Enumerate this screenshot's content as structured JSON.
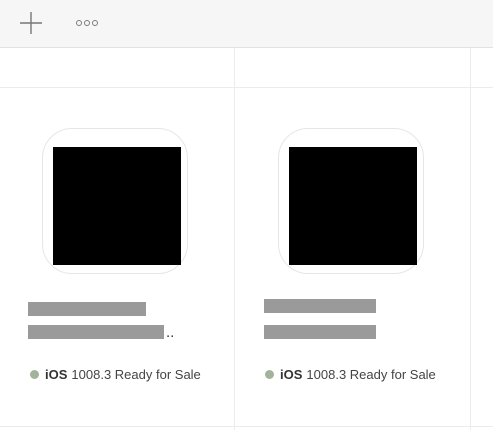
{
  "toolbar": {
    "add_icon": "plus-icon",
    "more_icon": "ellipsis-icon"
  },
  "apps": [
    {
      "name_line1": "",
      "name_line2": "",
      "name_truncated_suffix": "..",
      "platform": "iOS",
      "version": "1008.3",
      "status": "Ready for Sale",
      "status_color": "#a3b39b"
    },
    {
      "name_line1": "",
      "name_line2": "",
      "name_truncated_suffix": "",
      "platform": "iOS",
      "version": "1008.3",
      "status": "Ready for Sale",
      "status_color": "#a3b39b"
    }
  ],
  "colors": {
    "toolbar_bg": "#f6f6f6",
    "border": "#ececec",
    "redaction": "#9a9a9a"
  }
}
